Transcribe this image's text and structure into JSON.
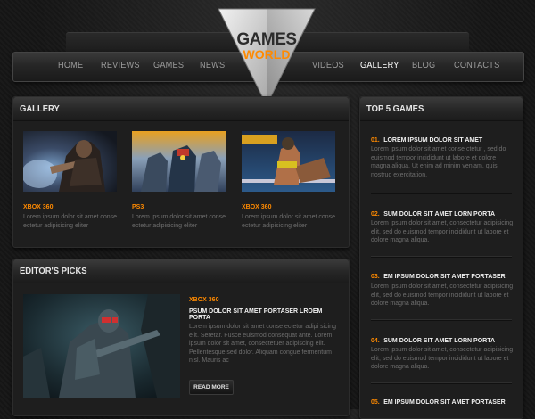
{
  "logo": {
    "line1": "GAMES",
    "line2": "WORLD"
  },
  "nav": {
    "items": [
      "HOME",
      "REVIEWS",
      "GAMES",
      "NEWS",
      "VIDEOS",
      "GALLERY",
      "BLOG",
      "CONTACTS"
    ],
    "active": "GALLERY"
  },
  "gallery": {
    "title": "GALLERY",
    "items": [
      {
        "platform": "XBOX 360",
        "text": "Lorem ipsum dolor sit amet conse ectetur adipisicing eliter"
      },
      {
        "platform": "PS3",
        "text": "Lorem ipsum dolor sit amet conse ectetur adipisicing eliter"
      },
      {
        "platform": "XBOX 360",
        "text": "Lorem ipsum dolor sit amet conse ectetur adipisicing eliter"
      }
    ]
  },
  "editors": {
    "title": "EDITOR'S PICKS",
    "platform": "XBOX 360",
    "headline": "PSUM DOLOR SIT AMET PORTASER LROEM PORTA",
    "text": "Lorem ipsum dolor sit amet conse ectetur adipi sicing elit. Seretar. Fusce euismod consequat ante. Lorem ipsum dolor sit amet, consectetuer adipiscing elit. Pellentesque sed dolor. Aliquam congue fermentum nisl. Mauris ac",
    "read_more": "READ MORE"
  },
  "top5": {
    "title": "TOP 5 GAMES",
    "items": [
      {
        "num": "01.",
        "title": "LOREM IPSUM DOLOR SIT AMET",
        "text": "Lorem ipsum dolor sit amet conse ctetur , sed do euismod tempor incididunt ut labore et dolore magna aliqua. Ut enim ad minim veniam, quis nostrud exercitation."
      },
      {
        "num": "02.",
        "title": "SUM DOLOR SIT AMET LORN PORTA",
        "text": "Lorem ipsum dolor sit amet, consectetur adipisicing elit, sed do euismod tempor incididunt ut labore et dolore magna aliqua."
      },
      {
        "num": "03.",
        "title": "EM IPSUM DOLOR SIT AMET PORTASER",
        "text": "Lorem ipsum dolor sit amet, consectetur adipisicing elit, sed do euismod tempor incididunt ut labore et dolore magna aliqua."
      },
      {
        "num": "04.",
        "title": "SUM DOLOR SIT AMET LORN PORTA",
        "text": "Lorem ipsum dolor sit amet, consectetur adipisicing elit, sed do euismod tempor incididunt ut labore et dolore magna aliqua."
      },
      {
        "num": "05.",
        "title": "EM IPSUM DOLOR SIT AMET PORTASER",
        "text": ""
      }
    ]
  }
}
